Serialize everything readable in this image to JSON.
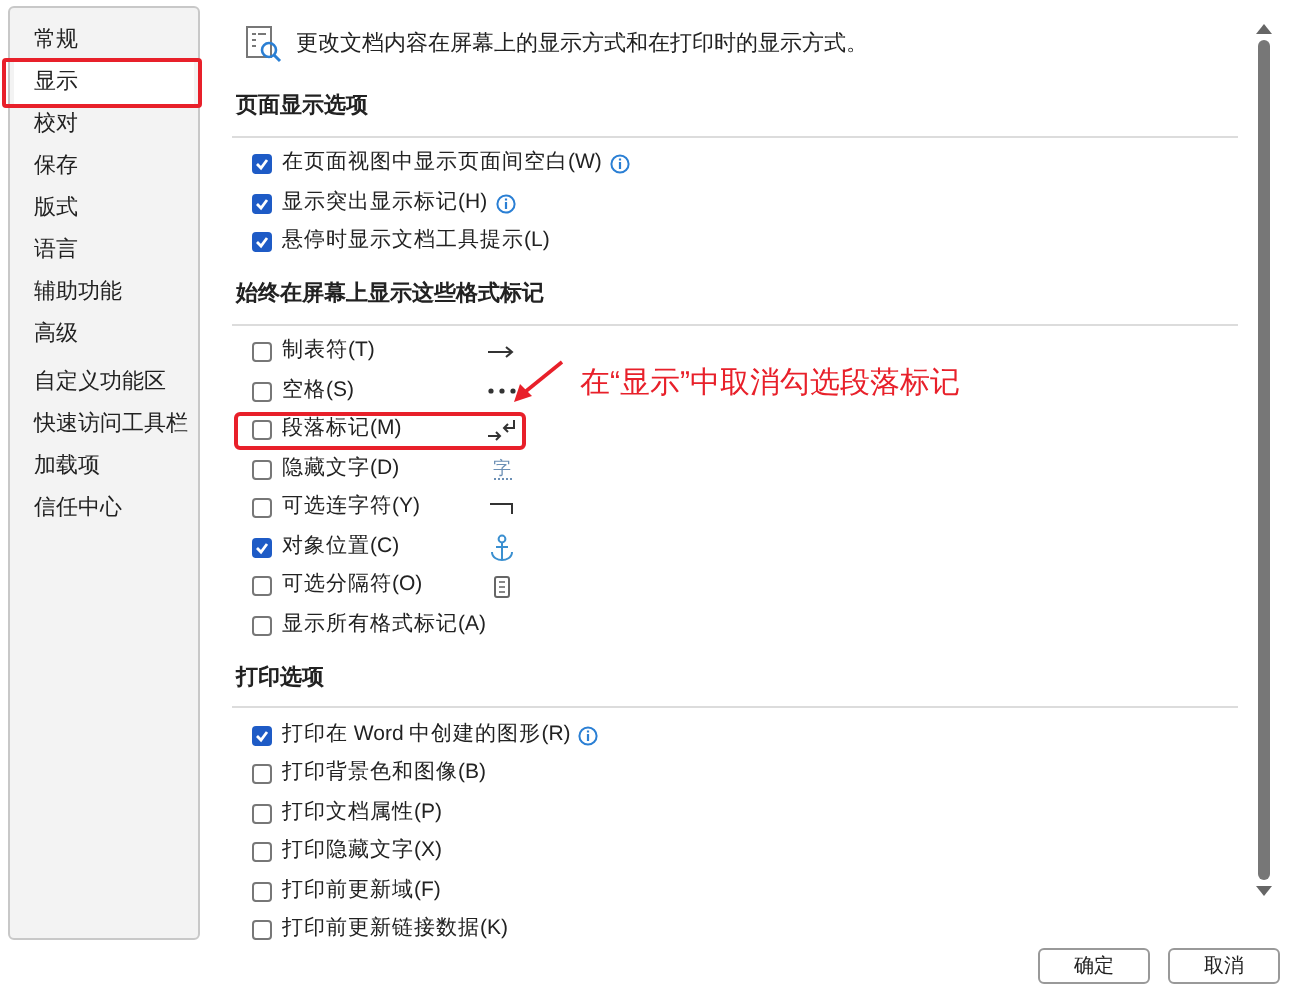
{
  "sidebar": {
    "items": [
      {
        "label": "常规",
        "selected": false,
        "circled": false
      },
      {
        "label": "显示",
        "selected": true,
        "circled": true
      },
      {
        "label": "校对",
        "selected": false,
        "circled": false
      },
      {
        "label": "保存",
        "selected": false,
        "circled": false
      },
      {
        "label": "版式",
        "selected": false,
        "circled": false
      },
      {
        "label": "语言",
        "selected": false,
        "circled": false
      },
      {
        "label": "辅助功能",
        "selected": false,
        "circled": false
      },
      {
        "label": "高级",
        "selected": false,
        "circled": false
      },
      {
        "label": "自定义功能区",
        "selected": false,
        "circled": false
      },
      {
        "label": "快速访问工具栏",
        "selected": false,
        "circled": false
      },
      {
        "label": "加载项",
        "selected": false,
        "circled": false
      },
      {
        "label": "信任中心",
        "selected": false,
        "circled": false
      }
    ]
  },
  "intro": "更改文档内容在屏幕上的显示方式和在打印时的显示方式。",
  "sections": [
    {
      "title": "页面显示选项",
      "kind": "plain",
      "options": [
        {
          "label": "在页面视图中显示页面间空白(W)",
          "checked": true,
          "info": true
        },
        {
          "label": "显示突出显示标记(H)",
          "checked": true,
          "info": true
        },
        {
          "label": "悬停时显示文档工具提示(L)",
          "checked": true,
          "info": false
        }
      ]
    },
    {
      "title": "始终在屏幕上显示这些格式标记",
      "kind": "marks",
      "options": [
        {
          "label": "制表符(T)",
          "checked": false,
          "info": false,
          "circled": false
        },
        {
          "label": "空格(S)",
          "checked": false,
          "info": false,
          "circled": false
        },
        {
          "label": "段落标记(M)",
          "checked": false,
          "info": false,
          "circled": true
        },
        {
          "label": "隐藏文字(D)",
          "checked": false,
          "info": false,
          "circled": false,
          "symbol": "字"
        },
        {
          "label": "可选连字符(Y)",
          "checked": false,
          "info": false,
          "circled": false
        },
        {
          "label": "对象位置(C)",
          "checked": true,
          "info": false,
          "circled": false
        },
        {
          "label": "可选分隔符(O)",
          "checked": false,
          "info": false,
          "circled": false
        },
        {
          "label": "显示所有格式标记(A)",
          "checked": false,
          "info": false,
          "circled": false
        }
      ]
    },
    {
      "title": "打印选项",
      "kind": "plain",
      "options": [
        {
          "label": "打印在 Word 中创建的图形(R)",
          "checked": true,
          "info": true
        },
        {
          "label": "打印背景色和图像(B)",
          "checked": false,
          "info": false
        },
        {
          "label": "打印文档属性(P)",
          "checked": false,
          "info": false
        },
        {
          "label": "打印隐藏文字(X)",
          "checked": false,
          "info": false
        },
        {
          "label": "打印前更新域(F)",
          "checked": false,
          "info": false
        },
        {
          "label": "打印前更新链接数据(K)",
          "checked": false,
          "info": false
        }
      ]
    }
  ],
  "annotation": "在“显示”中取消勾选段落标记",
  "buttons": [
    "确定",
    "取消"
  ]
}
